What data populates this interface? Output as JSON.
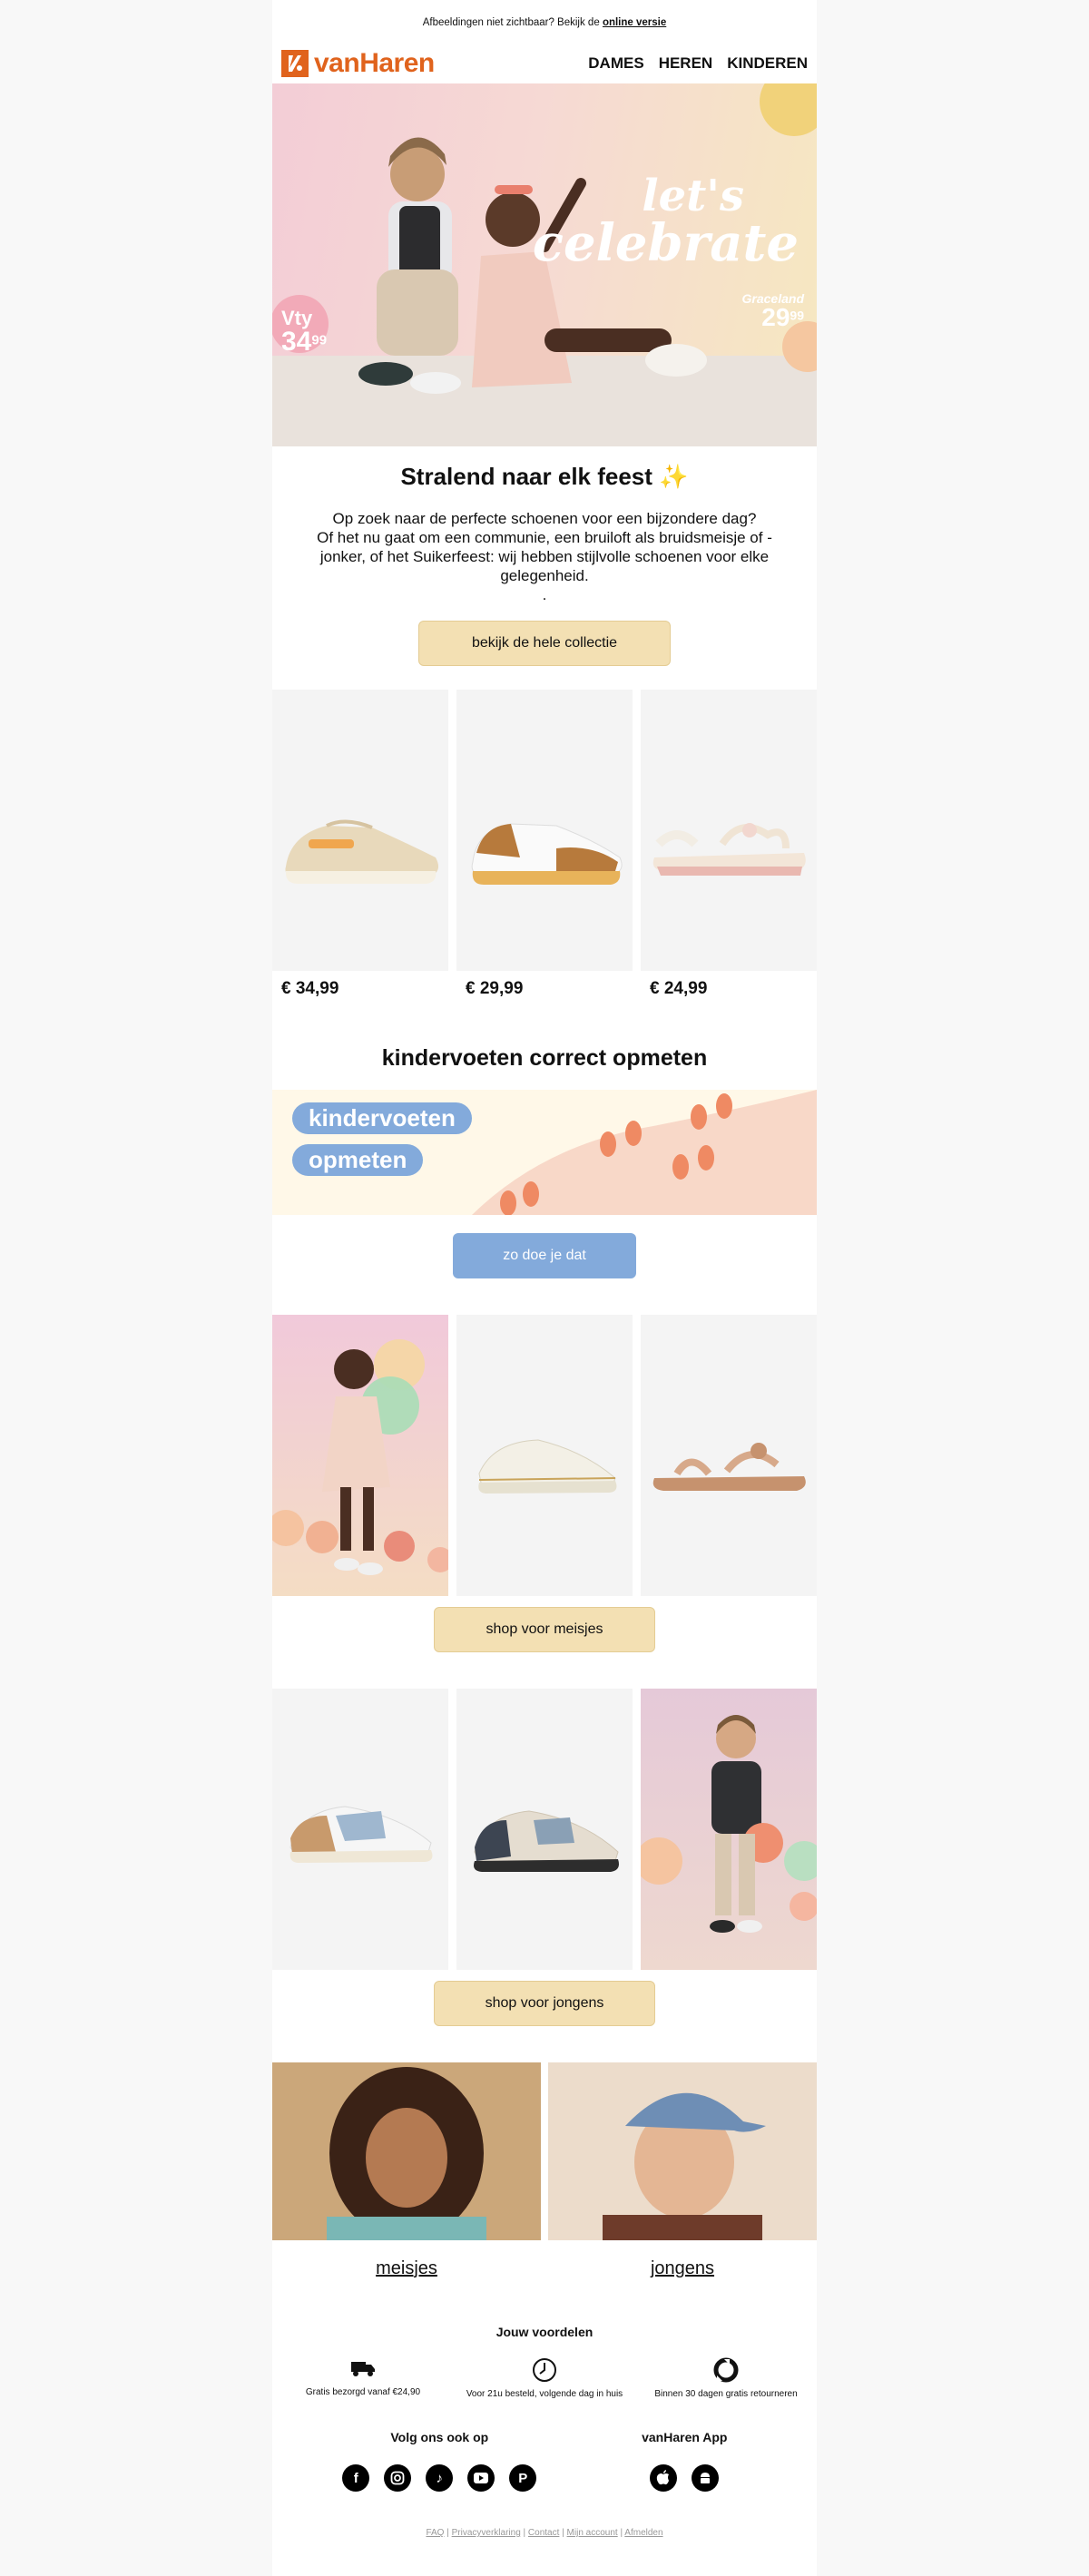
{
  "topbar": {
    "text": "Afbeeldingen niet zichtbaar? Bekijk de",
    "link": "online versie"
  },
  "brand": {
    "name": "vanHaren",
    "color": "#e0631d"
  },
  "nav": [
    "DAMES",
    "HEREN",
    "KINDEREN"
  ],
  "hero": {
    "headline_1": "let's",
    "headline_2": "celebrate",
    "left_brand": "Vty",
    "left_price_main": "34",
    "left_price_cents": "99",
    "right_brand": "Graceland",
    "right_price_main": "29",
    "right_price_cents": "99"
  },
  "intro": {
    "title": "Stralend naar elk feest ✨",
    "line_1": "Op zoek naar de perfecte schoenen voor een bijzondere dag?",
    "line_2": "Of het nu gaat om een communie, een bruiloft als bruidsmeisje of -jonker, of het Suikerfeest: wij hebben stijlvolle schoenen voor elke gelegenheid.",
    "line_3": ".",
    "button": "bekijk de hele collectie"
  },
  "products": [
    {
      "price": "€ 34,99",
      "icon": "sneaker-icon"
    },
    {
      "price": "€ 29,99",
      "icon": "sneaker-icon"
    },
    {
      "price": "€ 24,99",
      "icon": "sandal-icon"
    }
  ],
  "measure": {
    "title": "kindervoeten correct opmeten",
    "banner_1": "kindervoeten",
    "banner_2": "opmeten",
    "button": "zo doe je dat"
  },
  "girls": {
    "button": "shop voor meisjes"
  },
  "boys": {
    "button": "shop voor jongens"
  },
  "categories": [
    "meisjes",
    "jongens"
  ],
  "benefits": {
    "title": "Jouw voordelen",
    "items": [
      {
        "icon": "truck-icon",
        "text": "Gratis bezorgd vanaf €24,90"
      },
      {
        "icon": "clock-icon",
        "text": "Voor 21u besteld, volgende dag in huis"
      },
      {
        "icon": "return-icon",
        "text": "Binnen 30 dagen gratis retourneren"
      }
    ]
  },
  "follow": {
    "title": "Volg ons ook op",
    "icons": [
      "facebook-icon",
      "instagram-icon",
      "tiktok-icon",
      "youtube-icon",
      "pinterest-icon"
    ]
  },
  "app": {
    "title": "vanHaren App",
    "icons": [
      "apple-icon",
      "android-icon"
    ]
  },
  "footer": [
    "FAQ",
    "Privacyverklaring",
    "Contact",
    "Mijn account",
    "Afmelden"
  ],
  "colors": {
    "accent": "#e0631d",
    "gold_button": "#f3e0b3",
    "blue_button": "#83aadb",
    "tile_bg": "#f4f4f4"
  }
}
